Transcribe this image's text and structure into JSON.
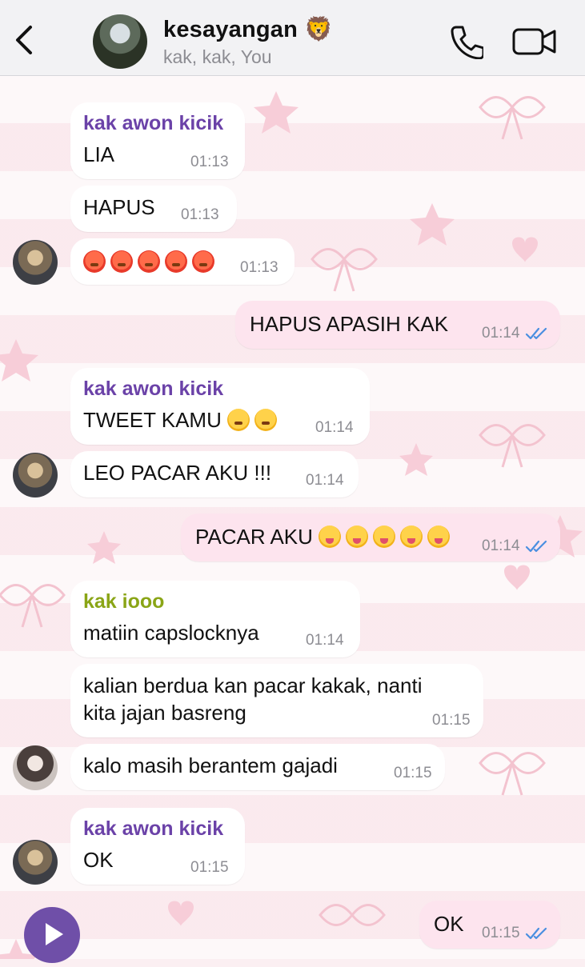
{
  "header": {
    "title": "kesayangan 🦁",
    "subtitle": "kak, kak, You"
  },
  "colors": {
    "sender_purple": "#6b42a8",
    "sender_olive": "#8aa516",
    "outgoing_bubble": "#fde4ee",
    "incoming_bubble": "#ffffff",
    "read_ticks": "#4a8fe0"
  },
  "messages": [
    {
      "sender": "kak awon kicik",
      "text": "LIA",
      "time": "01:13"
    },
    {
      "text": "HAPUS",
      "time": "01:13"
    },
    {
      "text": "😡😡😡😡😡",
      "time": "01:13"
    },
    {
      "text": "HAPUS APASIH KAK",
      "time": "01:14"
    },
    {
      "sender": "kak awon kicik",
      "text": "TWEET KAMU 😒😒",
      "time": "01:14"
    },
    {
      "text": "LEO PACAR AKU !!!",
      "time": "01:14"
    },
    {
      "text": "PACAR AKU 😝😝😝😝😝",
      "time": "01:14"
    },
    {
      "sender": "kak iooo",
      "text": "matiin capslocknya",
      "time": "01:14"
    },
    {
      "text_line1": "kalian berdua kan pacar kakak, nanti",
      "text_line2": "kita jajan basreng",
      "time": "01:15"
    },
    {
      "text": "kalo masih berantem gajadi",
      "time": "01:15"
    },
    {
      "sender": "kak awon kicik",
      "text": "OK",
      "time": "01:15"
    },
    {
      "text": "OK",
      "time": "01:15"
    }
  ],
  "icons": [
    "back-chevron-icon",
    "phone-icon",
    "video-icon",
    "double-check-icon",
    "play-icon"
  ]
}
